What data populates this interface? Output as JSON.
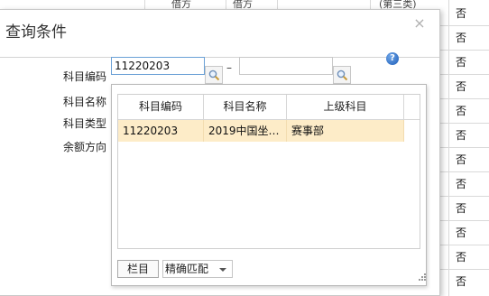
{
  "background": {
    "column_values": [
      "否",
      "否",
      "否",
      "否",
      "否",
      "否",
      "否",
      "否",
      "否",
      "否",
      "否",
      "否"
    ],
    "top_fragments": [
      "借方",
      "借方",
      "(第三类)"
    ]
  },
  "dialog": {
    "title": "查询条件",
    "close_glyph": "×",
    "labels": {
      "subject_code": "科目编码",
      "subject_name": "科目名称",
      "subject_type": "科目类型",
      "balance_direction": "余额方向"
    },
    "subject_code_from": "11220203",
    "subject_code_to": "",
    "dash": "–",
    "help_glyph": "?"
  },
  "popup": {
    "columns": [
      "科目编码",
      "科目名称",
      "上级科目"
    ],
    "rows": [
      {
        "code": "11220203",
        "name": "2019中国坐…",
        "parent": "赛事部"
      }
    ],
    "columns_button": "栏目",
    "match_mode": "精确匹配"
  }
}
